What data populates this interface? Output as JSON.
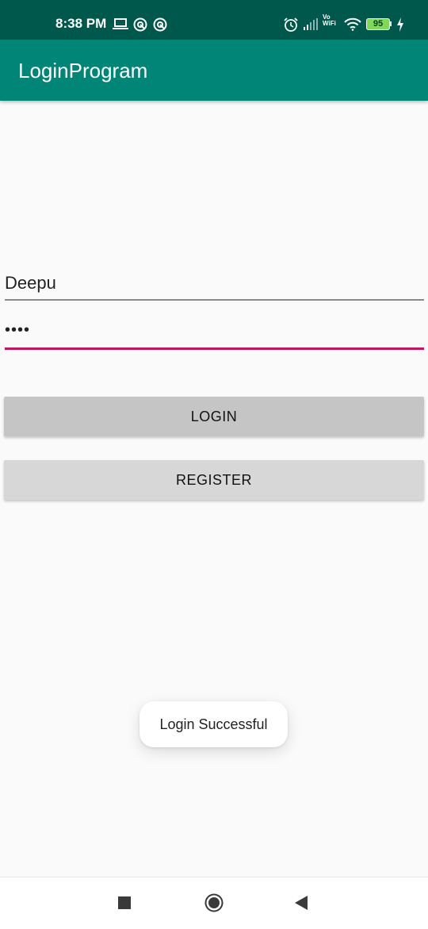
{
  "status_bar": {
    "time": "8:38 PM",
    "volte_label": "Vo\nWiFi",
    "battery_level": "95",
    "icons": [
      "laptop-icon",
      "circle-notification-icon",
      "circle-notification-icon",
      "alarm-icon",
      "signal-icon",
      "volte-wifi-icon",
      "wifi-icon",
      "battery-icon",
      "charging-icon"
    ]
  },
  "app_bar": {
    "title": "LoginProgram"
  },
  "form": {
    "username_value": "Deepu",
    "password_value": "••••"
  },
  "buttons": {
    "login_label": "LOGIN",
    "register_label": "REGISTER"
  },
  "toast": {
    "message": "Login Successful"
  },
  "navigation": {
    "icons": [
      "recent-apps-icon",
      "home-icon",
      "back-icon"
    ]
  },
  "colors": {
    "status_bar": "#00574b",
    "app_bar": "#008577",
    "focused_underline": "#c2185b",
    "battery_fill": "#7ed957"
  }
}
